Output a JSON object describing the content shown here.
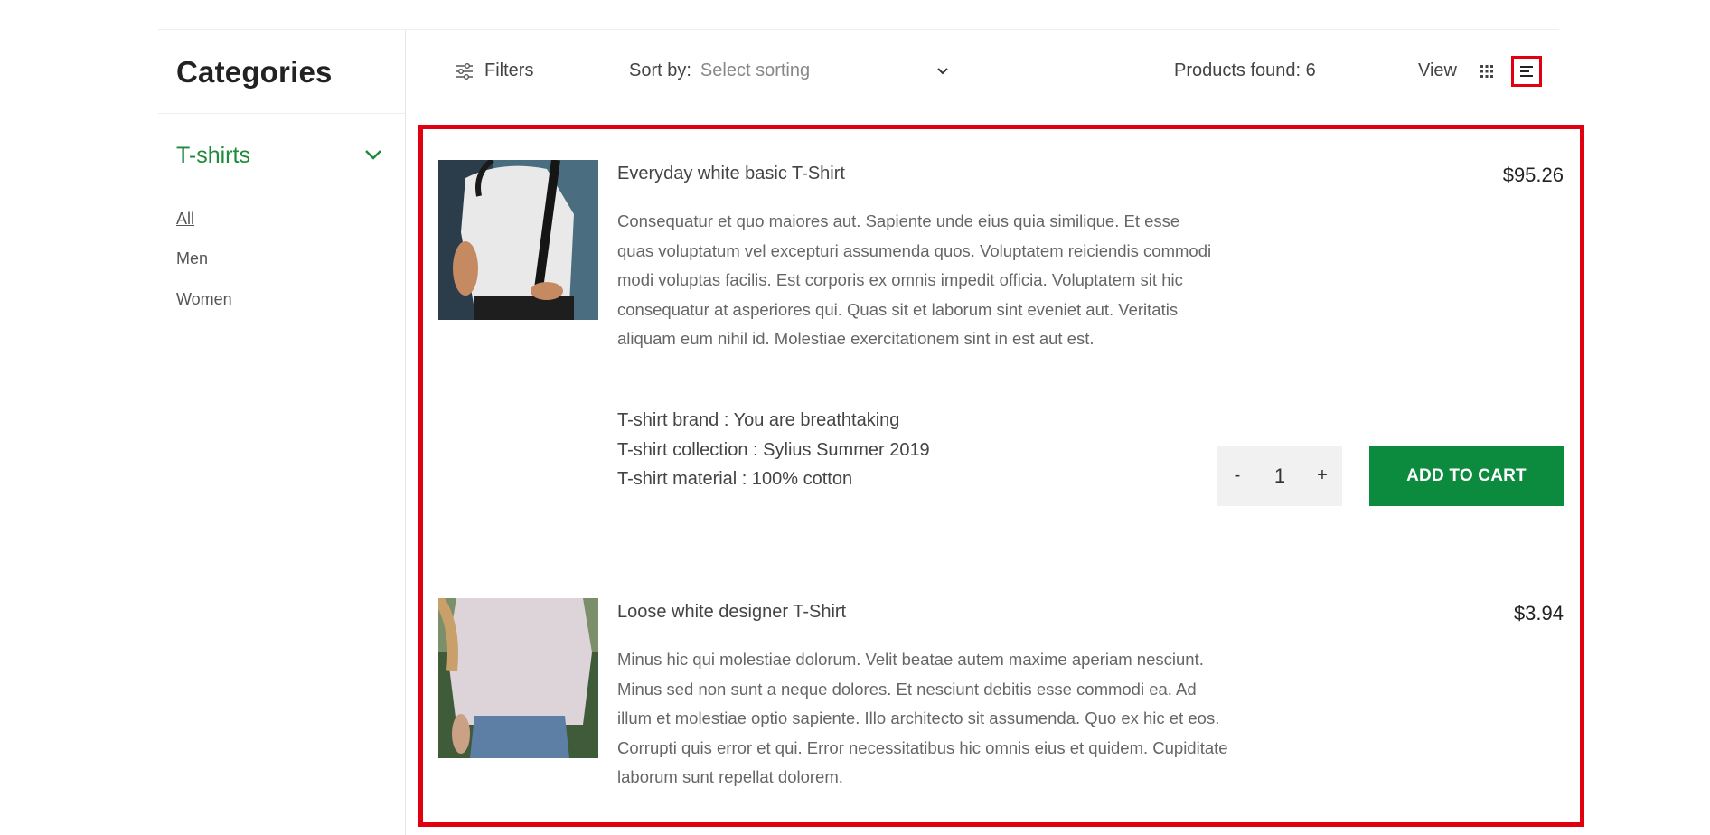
{
  "sidebar": {
    "title": "Categories",
    "category": "T-shirts",
    "subcategories": [
      "All",
      "Men",
      "Women"
    ]
  },
  "toolbar": {
    "filters_label": "Filters",
    "sort_label": "Sort by:",
    "sort_value": "Select sorting",
    "products_found_label": "Products found:",
    "products_found_count": "6",
    "view_label": "View"
  },
  "products": [
    {
      "name": "Everyday white basic T-Shirt",
      "price": "$95.26",
      "description": "Consequatur et quo maiores aut. Sapiente unde eius quia similique. Et esse quas voluptatum vel excepturi assumenda quos. Voluptatem reiciendis commodi modi voluptas facilis. Est corporis ex omnis impedit officia. Voluptatem sit hic consequatur at asperiores qui. Quas sit et laborum sint eveniet aut. Veritatis aliquam eum nihil id. Molestiae exercitationem sint in est aut est.",
      "brand": "T-shirt brand :  You are breathtaking",
      "collection": "T-shirt collection :  Sylius Summer 2019",
      "material": "T-shirt material :  100% cotton",
      "quantity": "1",
      "minus": "-",
      "plus": "+",
      "add_to_cart": "ADD TO CART"
    },
    {
      "name": "Loose white designer T-Shirt",
      "price": "$3.94",
      "description": "Minus hic qui molestiae dolorum. Velit beatae autem maxime aperiam nesciunt. Minus sed non sunt a neque dolores. Et nesciunt debitis esse commodi ea. Ad illum et molestiae optio sapiente. Illo architecto sit assumenda. Quo ex hic et eos. Corrupti quis error et qui. Error necessitatibus hic omnis eius et quidem. Cupiditate laborum sunt repellat dolorem."
    }
  ],
  "colors": {
    "accent": "#0c8a3d",
    "highlight": "#e10010"
  }
}
